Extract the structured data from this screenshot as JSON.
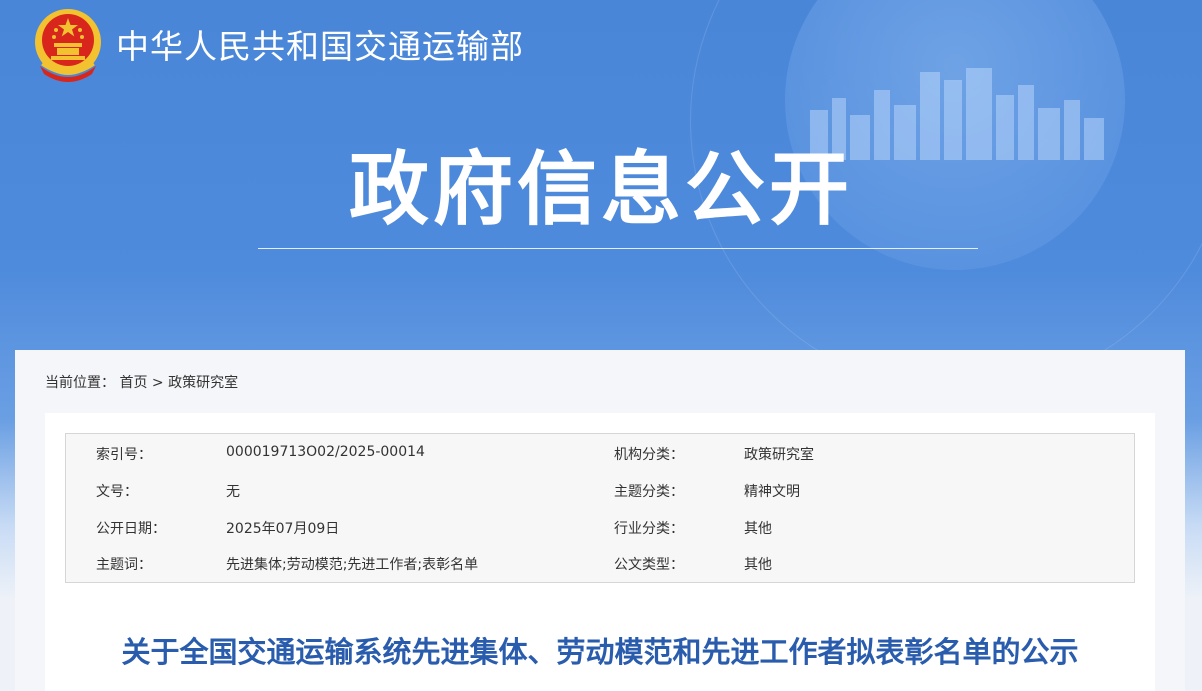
{
  "header": {
    "site_name": "中华人民共和国交通运输部",
    "title": "政府信息公开"
  },
  "breadcrumb": {
    "prefix": "当前位置：",
    "home": "首页",
    "separator": ">",
    "current": "政策研究室"
  },
  "meta": {
    "index_no_label": "索引号：",
    "index_no_value": "000019713O02/2025-00014",
    "org_label": "机构分类：",
    "org_value": "政策研究室",
    "doc_no_label": "文号：",
    "doc_no_value": "无",
    "topic_label": "主题分类：",
    "topic_value": "精神文明",
    "date_label": "公开日期：",
    "date_value": "2025年07月09日",
    "industry_label": "行业分类：",
    "industry_value": "其他",
    "keywords_label": "主题词：",
    "keywords_value": "先进集体;劳动模范;先进工作者;表彰名单",
    "doctype_label": "公文类型：",
    "doctype_value": "其他"
  },
  "article": {
    "title": "关于全国交通运输系统先进集体、劳动模范和先进工作者拟表彰名单的公示"
  },
  "colors": {
    "banner_blue": "#4a86d8",
    "title_blue": "#2a5cad",
    "emblem_red": "#d8261c",
    "emblem_gold": "#f2c230"
  }
}
